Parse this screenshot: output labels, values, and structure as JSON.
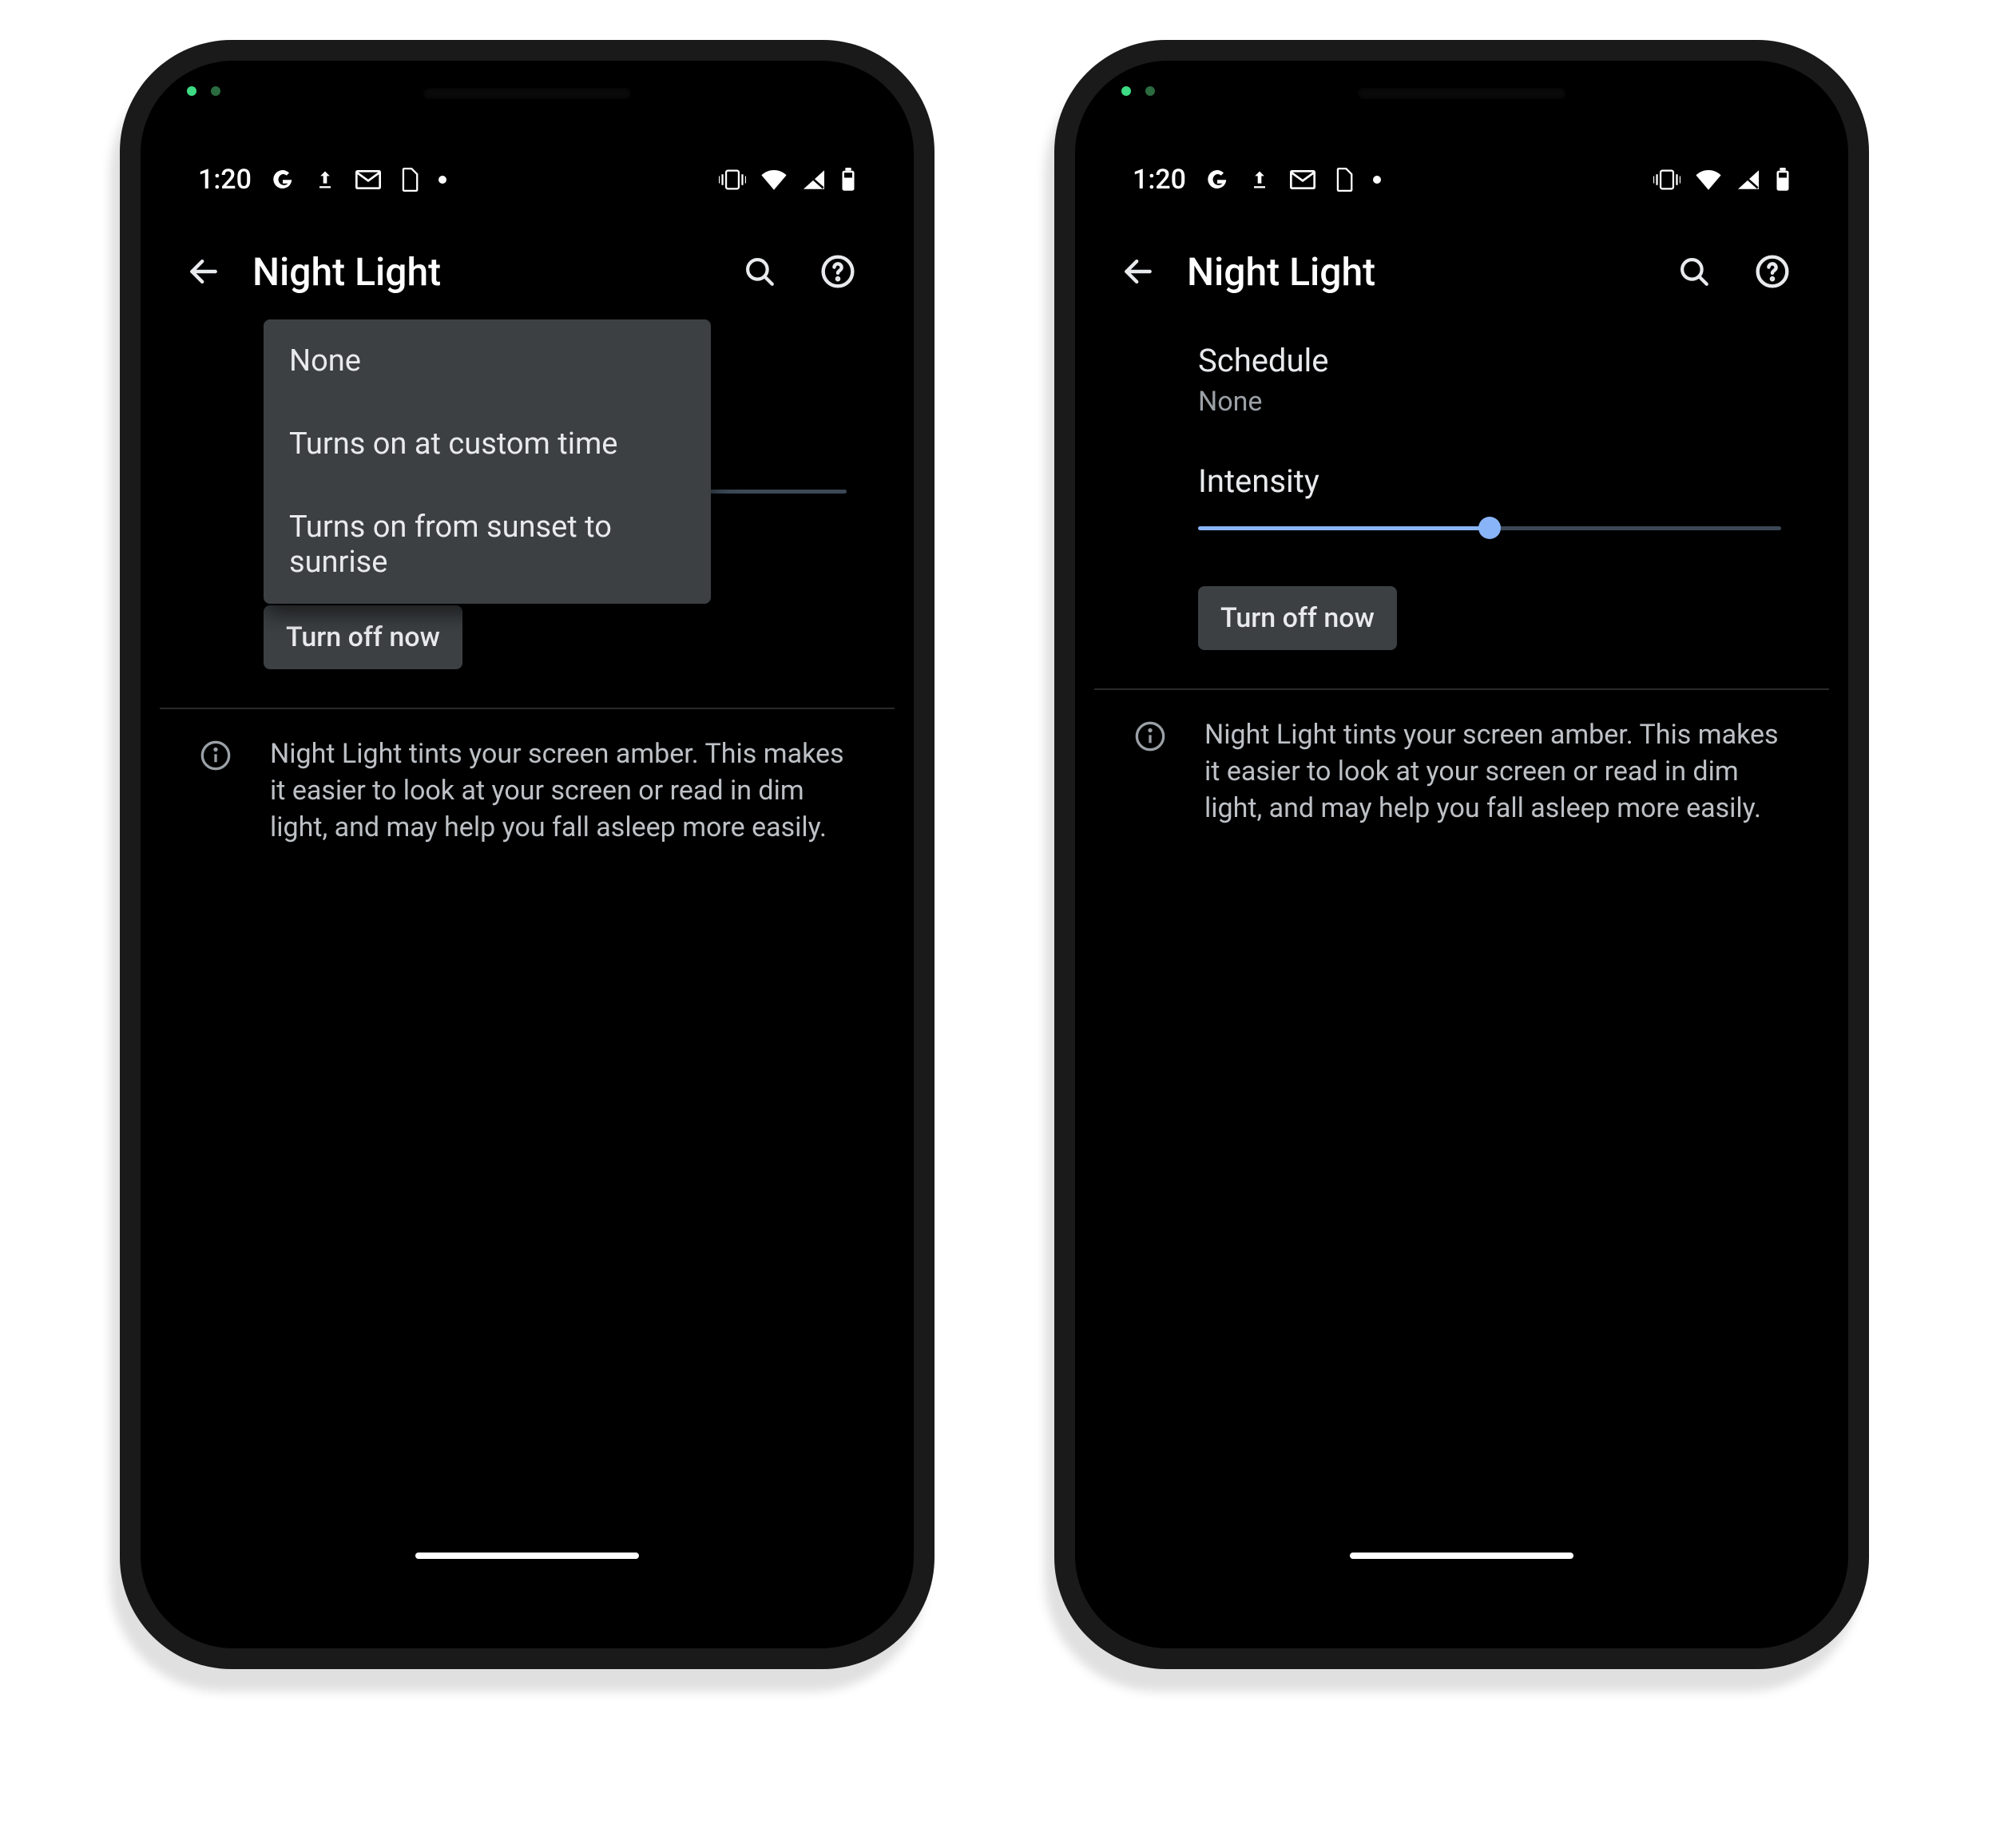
{
  "status": {
    "time": "1:20",
    "icons_left": [
      "google-icon",
      "upload-icon",
      "gmail-icon",
      "sim-icon",
      "dot-icon"
    ],
    "icons_right": [
      "vibrate-icon",
      "wifi-icon",
      "signal-icon",
      "battery-icon"
    ]
  },
  "header": {
    "title": "Night Light"
  },
  "settings": {
    "schedule_label": "Schedule",
    "schedule_value": "None",
    "intensity_label": "Intensity",
    "intensity_percent": 50
  },
  "menu": {
    "options": [
      "None",
      "Turns on at custom time",
      "Turns on from sunset to sunrise"
    ]
  },
  "action": {
    "turn_off_label": "Turn off now"
  },
  "info": {
    "text": "Night Light tints your screen amber. This makes it easier to look at your screen or read in dim light, and may help you fall asleep more easily."
  },
  "colors": {
    "accent": "#8ab4f8",
    "surface_variant": "#3c4043",
    "on_surface": "#e8eaed",
    "secondary_text": "#9aa0a6"
  }
}
